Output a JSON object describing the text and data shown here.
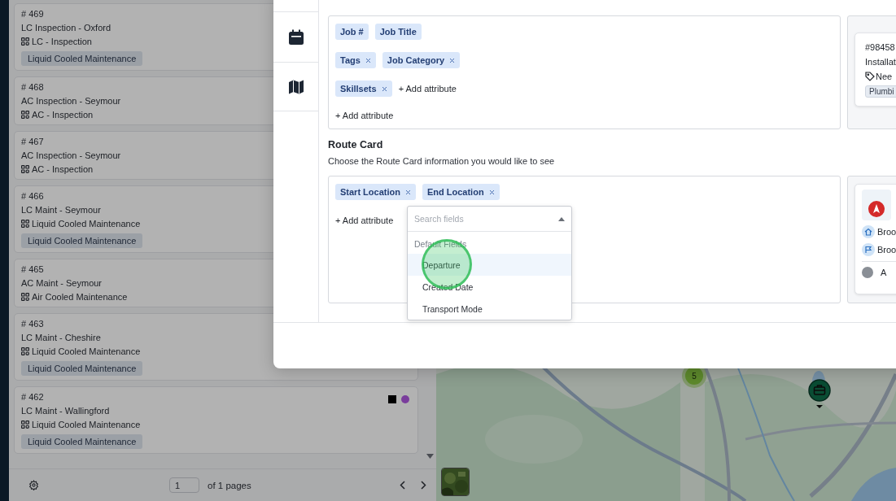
{
  "job_list": {
    "jobs": [
      {
        "number": "# 469",
        "title": "LC Inspection - Oxford",
        "category": "LC - Inspection",
        "tag": "Liquid Cooled Maintenance"
      },
      {
        "number": "# 468",
        "title": "AC Inspection - Seymour",
        "category": "AC - Inspection"
      },
      {
        "number": "# 467",
        "title": "AC Inspection - Seymour",
        "category": "AC - Inspection"
      },
      {
        "number": "# 466",
        "title": "LC Maint - Seymour",
        "category": "Liquid Cooled Maintenance",
        "tag": "Liquid Cooled Maintenance"
      },
      {
        "number": "# 465",
        "title": "AC Maint - Seymour",
        "category": "Air Cooled Maintenance"
      },
      {
        "number": "# 463",
        "title": "LC Maint - Cheshire",
        "category": "Liquid Cooled Maintenance",
        "tag": "Liquid Cooled Maintenance"
      },
      {
        "number": "# 462",
        "title": "LC Maint - Wallingford",
        "category": "Liquid Cooled Maintenance",
        "tag": "Liquid Cooled Maintenance",
        "markers": [
          {
            "kind": "square",
            "color": "#000000"
          },
          {
            "kind": "dot",
            "color": "#7a3d9c"
          }
        ]
      }
    ],
    "pagination": {
      "page": "1",
      "total": "of 1 pages"
    }
  },
  "map": {
    "cluster_count": "5"
  },
  "settings_modal": {
    "job_card": {
      "rows": [
        {
          "items": [
            {
              "kind": "chip",
              "label": "Job #",
              "removable": false
            },
            {
              "kind": "chip",
              "label": "Job Title",
              "removable": false
            }
          ]
        },
        {
          "items": [
            {
              "kind": "chip",
              "label": "Tags",
              "removable": true
            },
            {
              "kind": "chip",
              "label": "Job Category",
              "removable": true
            }
          ]
        },
        {
          "items": [
            {
              "kind": "chip",
              "label": "Skillsets",
              "removable": true
            },
            {
              "kind": "add",
              "label": "+ Add attribute"
            }
          ]
        },
        {
          "items": [
            {
              "kind": "add",
              "label": "+ Add attribute"
            }
          ]
        }
      ],
      "preview": {
        "number": "#98458",
        "title": "Installat",
        "tag_text": "Nee",
        "badge": "Plumbi"
      }
    },
    "route_card": {
      "heading": "Route Card",
      "description": "Choose the Route Card information you would like to see",
      "rows": [
        {
          "items": [
            {
              "kind": "chip",
              "label": "Start Location",
              "removable": true
            },
            {
              "kind": "chip",
              "label": "End Location",
              "removable": true
            }
          ]
        },
        {
          "items": [
            {
              "kind": "add",
              "label": "+ Add attribute"
            }
          ]
        }
      ],
      "dropdown": {
        "placeholder": "Search fields",
        "group": "Default Fields",
        "options": [
          {
            "label": "Departure",
            "selected": true
          },
          {
            "label": "Created Date",
            "selected": false
          },
          {
            "label": "Transport Mode",
            "selected": false
          }
        ]
      },
      "preview": {
        "start": "Broo",
        "end": "Broo",
        "assignee": "A"
      }
    }
  }
}
